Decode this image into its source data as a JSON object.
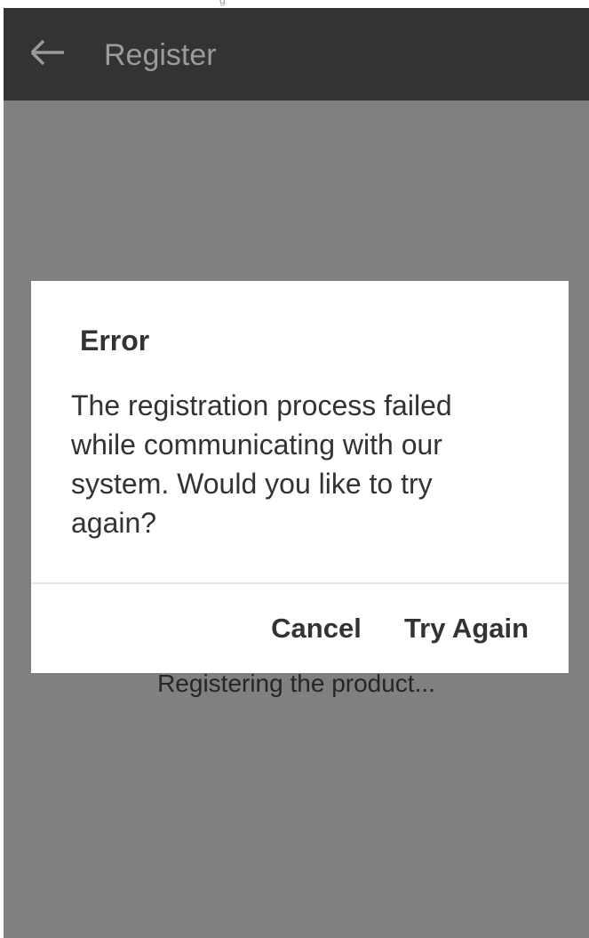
{
  "status_bar": {
    "partial_glyph": "g"
  },
  "app_bar": {
    "back_icon": "arrow-left-icon",
    "title": "Register"
  },
  "main": {
    "progress_text": "Registering the product..."
  },
  "dialog": {
    "title": "Error",
    "message": "The registration process failed while communicating with our system. Would you like to try again?",
    "buttons": {
      "cancel_label": "Cancel",
      "try_again_label": "Try Again"
    }
  },
  "colors": {
    "app_bar": "#333333",
    "title_text": "#9b9b9b",
    "scrim_background": "#808080",
    "dialog_background": "#ffffff",
    "dialog_text": "#333333",
    "divider": "#e6e6e6"
  }
}
